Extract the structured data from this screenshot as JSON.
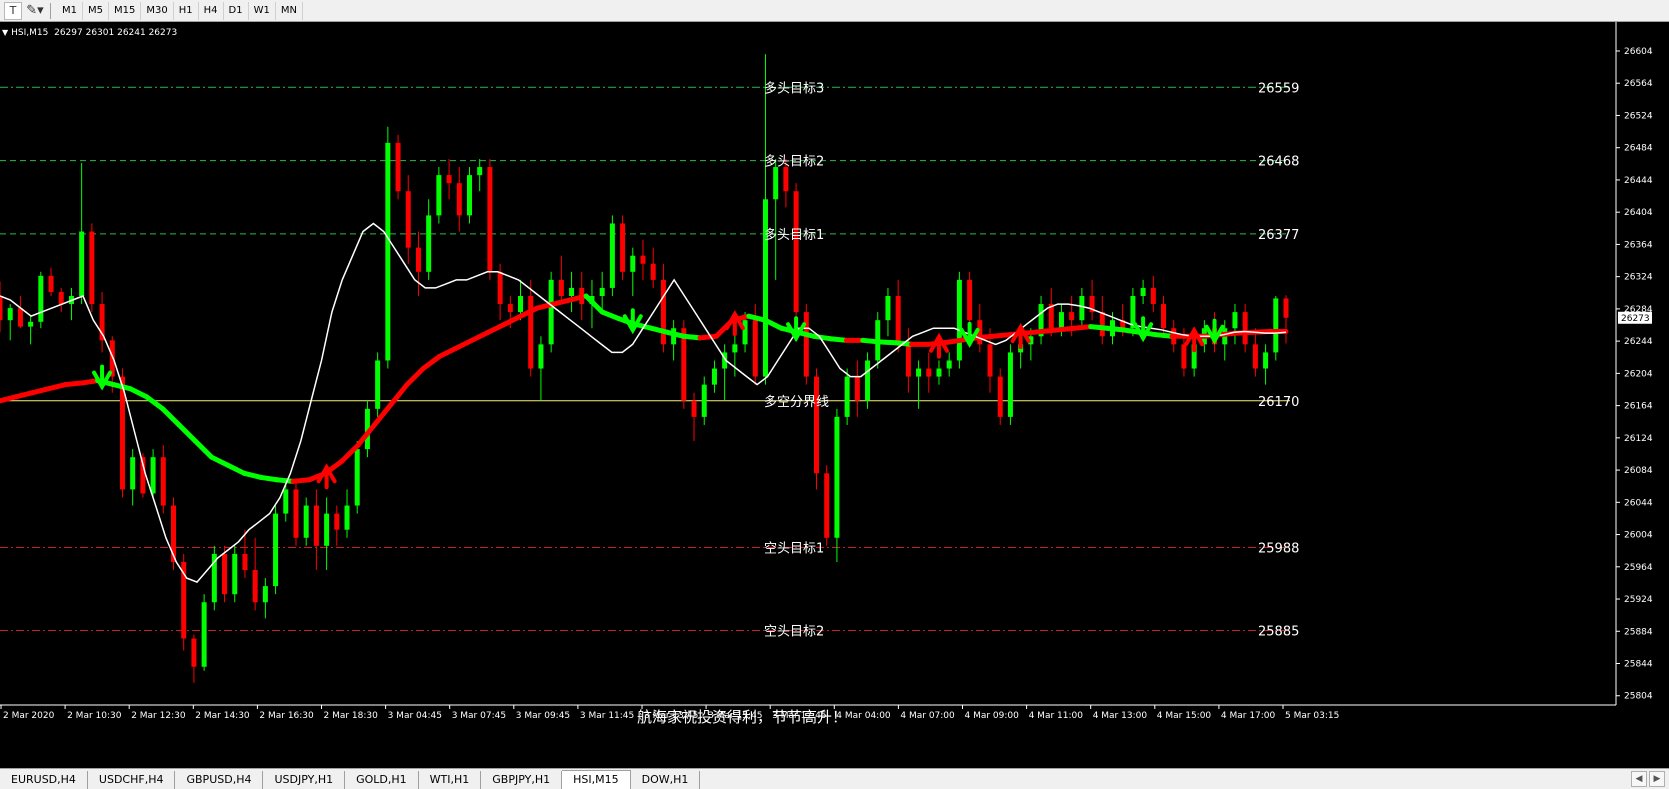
{
  "toolbar": {
    "periods": [
      "M1",
      "M5",
      "M15",
      "M30",
      "H1",
      "H4",
      "D1",
      "W1",
      "MN"
    ]
  },
  "symbol_info": {
    "symbol": "HSI,M15",
    "ohlc": "26297 26301 26241 26273"
  },
  "chart_data": {
    "type": "candlestick",
    "title": "",
    "y_ticks": [
      26604,
      26564,
      26524,
      26484,
      26444,
      26404,
      26364,
      26324,
      26284,
      26244,
      26204,
      26164,
      26124,
      26084,
      26044,
      26004,
      25964,
      25924,
      25884,
      25844,
      25804
    ],
    "ylim": [
      25795,
      26635
    ],
    "current_price": "26273",
    "x_ticks": [
      "2 Mar 2020",
      "2 Mar 10:30",
      "2 Mar 12:30",
      "2 Mar 14:30",
      "2 Mar 16:30",
      "2 Mar 18:30",
      "3 Mar 04:45",
      "3 Mar 07:45",
      "3 Mar 09:45",
      "3 Mar 11:45",
      "3 Mar 13:45",
      "3 Mar 15:45",
      "3 Mar 17:45",
      "4 Mar 04:00",
      "4 Mar 07:00",
      "4 Mar 09:00",
      "4 Mar 11:00",
      "4 Mar 13:00",
      "4 Mar 15:00",
      "4 Mar 17:00",
      "5 Mar 03:15"
    ],
    "levels": [
      {
        "label": "多头目标3",
        "value": "26559",
        "price": 26559,
        "color": "#2db84d",
        "style": "dashdot"
      },
      {
        "label": "多头目标2",
        "value": "26468",
        "price": 26468,
        "color": "#2db84d",
        "style": "dash"
      },
      {
        "label": "多头目标1",
        "value": "26377",
        "price": 26377,
        "color": "#2db84d",
        "style": "dash"
      },
      {
        "label": "多空分界线",
        "value": "26170",
        "price": 26170,
        "color": "#f5f07a",
        "style": "solid"
      },
      {
        "label": "空头目标1",
        "value": "25988",
        "price": 25988,
        "color": "#cc2020",
        "style": "dashdot"
      },
      {
        "label": "空头目标2",
        "value": "25885",
        "price": 25885,
        "color": "#cc2020",
        "style": "dashdot"
      }
    ],
    "annotation": "航海家祝投资得利，节节高升！",
    "colors": {
      "bull": "#00ff00",
      "bear": "#ff0000",
      "ma_fast": "#ffffff",
      "trend_up": "#ff0000",
      "trend_down": "#00ff00",
      "background": "#000000"
    },
    "candles": [
      [
        26300,
        26318,
        26255,
        26270
      ],
      [
        26270,
        26290,
        26245,
        26285
      ],
      [
        26285,
        26300,
        26260,
        26262
      ],
      [
        26262,
        26275,
        26240,
        26268
      ],
      [
        26268,
        26330,
        26260,
        26325
      ],
      [
        26325,
        26335,
        26300,
        26305
      ],
      [
        26305,
        26310,
        26280,
        26290
      ],
      [
        26290,
        26310,
        26270,
        26300
      ],
      [
        26300,
        26465,
        26290,
        26380
      ],
      [
        26380,
        26390,
        26280,
        26290
      ],
      [
        26290,
        26305,
        26230,
        26245
      ],
      [
        26245,
        26250,
        26180,
        26200
      ],
      [
        26200,
        26210,
        26050,
        26060
      ],
      [
        26060,
        26110,
        26040,
        26100
      ],
      [
        26100,
        26105,
        26050,
        26055
      ],
      [
        26055,
        26110,
        26050,
        26100
      ],
      [
        26100,
        26115,
        26030,
        26040
      ],
      [
        26040,
        26050,
        25960,
        25970
      ],
      [
        25970,
        25980,
        25860,
        25875
      ],
      [
        25875,
        25880,
        25820,
        25840
      ],
      [
        25840,
        25930,
        25835,
        25920
      ],
      [
        25920,
        25990,
        25910,
        25980
      ],
      [
        25980,
        25990,
        25920,
        25930
      ],
      [
        25930,
        25990,
        25920,
        25980
      ],
      [
        25980,
        26010,
        25950,
        25960
      ],
      [
        25960,
        26000,
        25910,
        25920
      ],
      [
        25920,
        25950,
        25900,
        25940
      ],
      [
        25940,
        26040,
        25930,
        26030
      ],
      [
        26030,
        26070,
        26020,
        26060
      ],
      [
        26060,
        26070,
        25990,
        26000
      ],
      [
        26000,
        26050,
        25990,
        26040
      ],
      [
        26040,
        26060,
        25960,
        25990
      ],
      [
        25990,
        26050,
        25960,
        26030
      ],
      [
        26030,
        26040,
        25990,
        26010
      ],
      [
        26010,
        26060,
        26000,
        26040
      ],
      [
        26040,
        26120,
        26030,
        26110
      ],
      [
        26110,
        26170,
        26100,
        26160
      ],
      [
        26160,
        26230,
        26150,
        26220
      ],
      [
        26220,
        26510,
        26210,
        26490
      ],
      [
        26490,
        26500,
        26420,
        26430
      ],
      [
        26430,
        26450,
        26340,
        26360
      ],
      [
        26360,
        26380,
        26300,
        26330
      ],
      [
        26330,
        26420,
        26320,
        26400
      ],
      [
        26400,
        26460,
        26390,
        26450
      ],
      [
        26450,
        26470,
        26420,
        26440
      ],
      [
        26440,
        26460,
        26380,
        26400
      ],
      [
        26400,
        26460,
        26390,
        26450
      ],
      [
        26450,
        26470,
        26430,
        26460
      ],
      [
        26460,
        26470,
        26320,
        26330
      ],
      [
        26330,
        26340,
        26270,
        26290
      ],
      [
        26290,
        26300,
        26260,
        26280
      ],
      [
        26280,
        26320,
        26270,
        26300
      ],
      [
        26300,
        26320,
        26200,
        26210
      ],
      [
        26210,
        26250,
        26170,
        26240
      ],
      [
        26240,
        26330,
        26230,
        26320
      ],
      [
        26320,
        26350,
        26290,
        26300
      ],
      [
        26300,
        26330,
        26280,
        26310
      ],
      [
        26310,
        26330,
        26270,
        26290
      ],
      [
        26290,
        26320,
        26260,
        26300
      ],
      [
        26300,
        26330,
        26280,
        26310
      ],
      [
        26310,
        26400,
        26300,
        26390
      ],
      [
        26390,
        26400,
        26320,
        26330
      ],
      [
        26330,
        26360,
        26300,
        26350
      ],
      [
        26350,
        26370,
        26320,
        26340
      ],
      [
        26340,
        26360,
        26310,
        26320
      ],
      [
        26320,
        26340,
        26230,
        26240
      ],
      [
        26240,
        26270,
        26220,
        26260
      ],
      [
        26260,
        26270,
        26160,
        26170
      ],
      [
        26170,
        26180,
        26120,
        26150
      ],
      [
        26150,
        26200,
        26140,
        26190
      ],
      [
        26190,
        26220,
        26180,
        26210
      ],
      [
        26210,
        26240,
        26170,
        26230
      ],
      [
        26230,
        26260,
        26200,
        26240
      ],
      [
        26240,
        26280,
        26230,
        26270
      ],
      [
        26270,
        26290,
        26190,
        26200
      ],
      [
        26200,
        26600,
        26190,
        26420
      ],
      [
        26420,
        26470,
        26320,
        26460
      ],
      [
        26460,
        26470,
        26410,
        26430
      ],
      [
        26430,
        26440,
        26270,
        26280
      ],
      [
        26280,
        26290,
        26190,
        26200
      ],
      [
        26200,
        26210,
        26060,
        26080
      ],
      [
        26080,
        26090,
        25990,
        26000
      ],
      [
        26000,
        26160,
        25970,
        26150
      ],
      [
        26150,
        26210,
        26140,
        26200
      ],
      [
        26200,
        26220,
        26150,
        26170
      ],
      [
        26170,
        26230,
        26160,
        26220
      ],
      [
        26220,
        26280,
        26210,
        26270
      ],
      [
        26270,
        26310,
        26250,
        26300
      ],
      [
        26300,
        26320,
        26230,
        26240
      ],
      [
        26240,
        26260,
        26180,
        26200
      ],
      [
        26200,
        26220,
        26160,
        26210
      ],
      [
        26210,
        26230,
        26180,
        26200
      ],
      [
        26200,
        26220,
        26190,
        26210
      ],
      [
        26210,
        26230,
        26200,
        26220
      ],
      [
        26220,
        26330,
        26210,
        26320
      ],
      [
        26320,
        26330,
        26260,
        26270
      ],
      [
        26270,
        26290,
        26230,
        26240
      ],
      [
        26240,
        26260,
        26180,
        26200
      ],
      [
        26200,
        26210,
        26140,
        26150
      ],
      [
        26150,
        26240,
        26140,
        26230
      ],
      [
        26230,
        26250,
        26210,
        26240
      ],
      [
        26240,
        26260,
        26220,
        26250
      ],
      [
        26250,
        26300,
        26240,
        26290
      ],
      [
        26290,
        26310,
        26250,
        26260
      ],
      [
        26260,
        26290,
        26250,
        26280
      ],
      [
        26280,
        26300,
        26250,
        26270
      ],
      [
        26270,
        26310,
        26260,
        26300
      ],
      [
        26300,
        26320,
        26270,
        26280
      ],
      [
        26280,
        26300,
        26240,
        26250
      ],
      [
        26250,
        26280,
        26240,
        26270
      ],
      [
        26270,
        26290,
        26250,
        26260
      ],
      [
        26260,
        26310,
        26250,
        26300
      ],
      [
        26300,
        26320,
        26290,
        26310
      ],
      [
        26310,
        26325,
        26280,
        26290
      ],
      [
        26290,
        26300,
        26250,
        26260
      ],
      [
        26260,
        26270,
        26230,
        26240
      ],
      [
        26240,
        26260,
        26200,
        26210
      ],
      [
        26210,
        26250,
        26200,
        26240
      ],
      [
        26240,
        26270,
        26230,
        26260
      ],
      [
        26260,
        26280,
        26230,
        26240
      ],
      [
        26240,
        26270,
        26220,
        26260
      ],
      [
        26260,
        26290,
        26240,
        26280
      ],
      [
        26280,
        26290,
        26230,
        26240
      ],
      [
        26240,
        26260,
        26200,
        26210
      ],
      [
        26210,
        26240,
        26190,
        26230
      ],
      [
        26230,
        26300,
        26220,
        26297
      ],
      [
        26297,
        26301,
        26241,
        26273
      ]
    ],
    "ma_fast": [
      26300,
      26295,
      26285,
      26275,
      26280,
      26285,
      26290,
      26295,
      26300,
      26270,
      26250,
      26220,
      26180,
      26130,
      26080,
      26040,
      26000,
      25970,
      25950,
      25945,
      25960,
      25975,
      25985,
      25995,
      26010,
      26020,
      26030,
      26050,
      26080,
      26120,
      26170,
      26220,
      26280,
      26320,
      26350,
      26380,
      26390,
      26380,
      26360,
      26340,
      26320,
      26310,
      26310,
      26315,
      26320,
      26320,
      26325,
      26330,
      26330,
      26325,
      26320,
      26310,
      26300,
      26290,
      26280,
      26270,
      26260,
      26250,
      26240,
      26230,
      26230,
      26240,
      26260,
      26280,
      26300,
      26320,
      26300,
      26280,
      26260,
      26240,
      26220,
      26210,
      26200,
      26190,
      26200,
      26220,
      26240,
      26260,
      26260,
      26250,
      26230,
      26210,
      26200,
      26200,
      26210,
      26220,
      26230,
      26240,
      26250,
      26255,
      26260,
      26260,
      26260,
      26255,
      26250,
      26245,
      26240,
      26245,
      26255,
      26265,
      26275,
      26285,
      26290,
      26290,
      26288,
      26285,
      26280,
      26275,
      26270,
      26265,
      26262,
      26260,
      26258,
      26255,
      26252,
      26250,
      26250,
      26250,
      26252,
      26255,
      26256,
      26255,
      26254,
      26254,
      26255
    ],
    "trend": [
      26170,
      26175,
      26180,
      26185,
      26190,
      26192,
      26195,
      26190,
      26185,
      26175,
      26160,
      26140,
      26120,
      26100,
      26090,
      26080,
      26075,
      26072,
      26070,
      26072,
      26080,
      26095,
      26115,
      26140,
      26165,
      26190,
      26210,
      26225,
      26235,
      26245,
      26255,
      26265,
      26275,
      26285,
      26290,
      26295,
      26300,
      26280,
      26272,
      26265,
      26260,
      26255,
      26250,
      26248,
      26250,
      26270,
      26275,
      26270,
      26260,
      26255,
      26250,
      26247,
      26245,
      26245,
      26243,
      26242,
      26240,
      26240,
      26242,
      26245,
      26248,
      26250,
      26252,
      26254,
      26256,
      26258,
      26260,
      26262,
      26260,
      26258,
      26255,
      26252,
      26250,
      26250,
      26250,
      26252,
      26254,
      26255,
      26256,
      26256
    ],
    "signals": [
      {
        "type": "down",
        "index": 10
      },
      {
        "type": "up",
        "index": 32
      },
      {
        "type": "down",
        "index": 62
      },
      {
        "type": "up",
        "index": 72
      },
      {
        "type": "down",
        "index": 78
      },
      {
        "type": "up",
        "index": 92
      },
      {
        "type": "down",
        "index": 95
      },
      {
        "type": "up",
        "index": 100
      },
      {
        "type": "down",
        "index": 112
      },
      {
        "type": "up",
        "index": 117
      },
      {
        "type": "down",
        "index": 119
      }
    ]
  },
  "tabs": [
    {
      "label": "EURUSD,H4",
      "active": false
    },
    {
      "label": "USDCHF,H4",
      "active": false
    },
    {
      "label": "GBPUSD,H4",
      "active": false
    },
    {
      "label": "USDJPY,H1",
      "active": false
    },
    {
      "label": "GOLD,H1",
      "active": false
    },
    {
      "label": "WTI,H1",
      "active": false
    },
    {
      "label": "GBPJPY,H1",
      "active": false
    },
    {
      "label": "HSI,M15",
      "active": true
    },
    {
      "label": "DOW,H1",
      "active": false
    }
  ]
}
